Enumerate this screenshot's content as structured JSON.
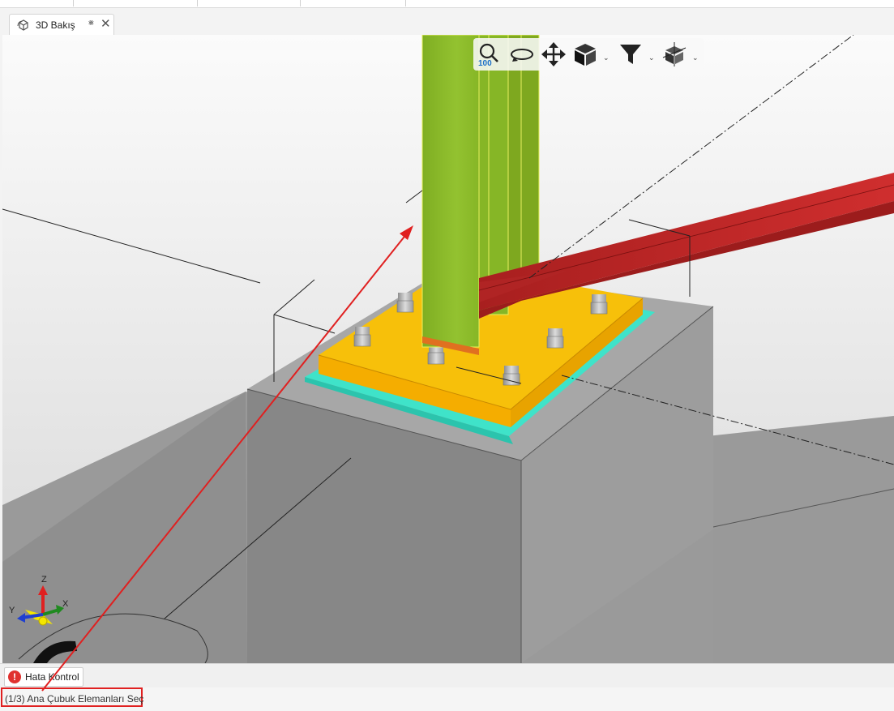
{
  "view_tab": {
    "label": "3D Bakış",
    "pin_glyph": "⨳",
    "close_glyph": "✕"
  },
  "toolbar": {
    "zoom_value": "100",
    "buttons": [
      "zoom-icon",
      "orbit-icon",
      "pan-icon",
      "view-cube-icon",
      "filter-icon",
      "section-box-icon"
    ]
  },
  "axis_gizmo": {
    "x": "X",
    "y": "Y",
    "z": "Z"
  },
  "error_tab": {
    "icon": "!",
    "label": "Hata Kontrol"
  },
  "status": {
    "text": "(1/3) Ana Çubuk Elemanları Seç"
  },
  "colors": {
    "column": "#8bb92c",
    "beam": "#c62828",
    "base_plate": "#f5b800",
    "grout": "#3fe0c8",
    "concrete": "#8f8f8f",
    "annotation": "#e02020"
  }
}
